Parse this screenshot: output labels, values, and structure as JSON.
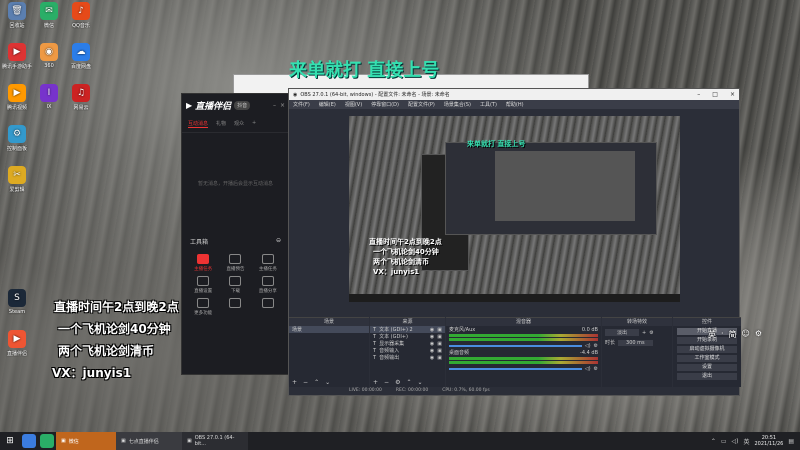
{
  "desktop": {
    "icons": [
      {
        "label": "回收站",
        "color": "#5b7fb0",
        "glyph": "🗑"
      },
      {
        "label": "微信",
        "color": "#2aae67",
        "glyph": "✉"
      },
      {
        "label": "QQ音乐",
        "color": "#e64a19",
        "glyph": "♪"
      },
      {
        "label": "腾讯手游助手",
        "color": "#d33",
        "glyph": "▶"
      },
      {
        "label": "360",
        "color": "#e94",
        "glyph": "◉"
      },
      {
        "label": "百度网盘",
        "color": "#2b7de9",
        "glyph": "☁"
      },
      {
        "label": "腾讯视频",
        "color": "#f90",
        "glyph": "▶"
      },
      {
        "label": "IX",
        "color": "#73c",
        "glyph": "I"
      },
      {
        "label": "网易云",
        "color": "#c22",
        "glyph": "♫"
      },
      {
        "label": "控制面板",
        "color": "#39c",
        "glyph": "⚙"
      },
      {
        "label": "爱剪辑",
        "color": "#da2",
        "glyph": "✂"
      },
      {
        "label": "Steam",
        "color": "#1b2838",
        "glyph": "S"
      },
      {
        "label": "直播伴侣",
        "color": "#e53",
        "glyph": "▶"
      }
    ]
  },
  "overlay": {
    "top_banner": "来单就打 直接上号",
    "lines": [
      "直播时间午2点到晚2点",
      "一个飞机论剑40分钟",
      "两个飞机论剑清币",
      "VX：junyis1"
    ]
  },
  "companion_app": {
    "logo": "直播伴侣",
    "badge": "抖音",
    "tabs": [
      "互动消息",
      "礼物",
      "观众",
      "+"
    ],
    "empty_text": "暂无消息，开播后会显示互动消息",
    "tools_title": "工具箱",
    "tools": [
      {
        "label": "主播任务",
        "hot": true
      },
      {
        "label": "直播预告",
        "hot": false
      },
      {
        "label": "主播任务",
        "hot": false
      },
      {
        "label": "直播设置",
        "hot": false
      },
      {
        "label": "下载",
        "hot": false
      },
      {
        "label": "直播分享",
        "hot": false
      },
      {
        "label": "更多功能",
        "hot": false
      },
      {
        "label": "",
        "hot": false
      },
      {
        "label": "",
        "hot": false
      }
    ]
  },
  "obs": {
    "title": "OBS 27.0.1 (64-bit, windows) - 配置文件: 未命名 - 场景: 未命名",
    "menu": [
      "文件(F)",
      "编辑(E)",
      "视图(V)",
      "停靠窗口(D)",
      "配置文件(P)",
      "场景集合(S)",
      "工具(T)",
      "帮助(H)"
    ],
    "scenes_title": "场景",
    "scenes": [
      "场景"
    ],
    "sources_title": "来源",
    "sources": [
      "文本 (GDI+) 2",
      "文本 (GDI+)",
      "显示器采集",
      "音频输入",
      "音频输出"
    ],
    "mixer_title": "混音器",
    "mixer": [
      {
        "name": "麦克风/Aux",
        "db": "0.0 dB"
      },
      {
        "name": "桌面音频",
        "db": "-4.4 dB"
      }
    ],
    "transitions_title": "转场特效",
    "transition": {
      "type": "淡出",
      "duration_label": "时长",
      "duration": "300 ms"
    },
    "controls_title": "控件",
    "controls": [
      "开始直播",
      "开始录制",
      "启动虚拟摄像机",
      "工作室模式",
      "设置",
      "退出"
    ],
    "status": [
      "LIVE: 00:00:00",
      "REC: 00:00:00",
      "CPU: 0.7%, 60.00 fps"
    ]
  },
  "taskbar": {
    "tasks": [
      {
        "label": "微信",
        "style": "orange"
      },
      {
        "label": "七点直播伴侣",
        "style": "dark"
      },
      {
        "label": "OBS 27.0.1 (64-bit...",
        "style": "dark2"
      }
    ],
    "ime": [
      "英",
      "·",
      "简",
      "☺",
      "⚙"
    ],
    "time": "20:51",
    "date": "2021/11/26"
  }
}
